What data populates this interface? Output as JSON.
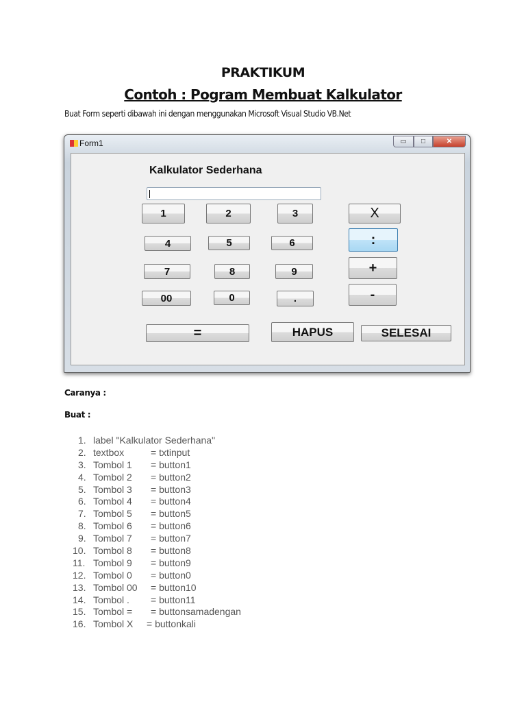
{
  "heading": "PRAKTIKUM",
  "title": "Contoh : Pogram Membuat Kalkulator",
  "subtitle": "Buat Form seperti dibawah ini dengan menggunakan Microsoft Visual Studio VB.Net",
  "window": {
    "title": "Form1",
    "minimize": "▭",
    "maximize": "□",
    "close": "✕",
    "label": "Kalkulator Sederhana",
    "textbox_value": "",
    "buttons": {
      "b1": "1",
      "b2": "2",
      "b3": "3",
      "kali": "X",
      "b4": "4",
      "b5": "5",
      "b6": "6",
      "bagi": ":",
      "b7": "7",
      "b8": "8",
      "b9": "9",
      "tambah": "+",
      "b00": "00",
      "b0": "0",
      "titik": ".",
      "kurang": "-",
      "sama": "=",
      "hapus": "HAPUS",
      "selesai": "SELESAI"
    }
  },
  "caranya": "Caranya :",
  "buat": "Buat :",
  "steps": [
    {
      "n": "1.",
      "a": "label \"Kalkulator Sederhana\"",
      "b": ""
    },
    {
      "n": "2.",
      "a": "textbox",
      "b": "= txtinput"
    },
    {
      "n": "3.",
      "a": "Tombol 1",
      "b": "= button1"
    },
    {
      "n": "4.",
      "a": "Tombol 2",
      "b": "= button2"
    },
    {
      "n": "5.",
      "a": "Tombol 3",
      "b": "= button3"
    },
    {
      "n": "6.",
      "a": "Tombol 4",
      "b": "= button4"
    },
    {
      "n": "7.",
      "a": "Tombol 5",
      "b": "= button5"
    },
    {
      "n": "8.",
      "a": "Tombol 6",
      "b": "= button6"
    },
    {
      "n": "9.",
      "a": "Tombol 7",
      "b": "= button7"
    },
    {
      "n": "10.",
      "a": "Tombol 8",
      "b": "= button8"
    },
    {
      "n": "11.",
      "a": "Tombol 9",
      "b": "= button9"
    },
    {
      "n": "12.",
      "a": "Tombol 0",
      "b": "= button0"
    },
    {
      "n": "13.",
      "a": "Tombol 00",
      "b": "= button10"
    },
    {
      "n": "14.",
      "a": "Tombol .",
      "b": "= button11"
    },
    {
      "n": "15.",
      "a": "Tombol =",
      "b": "= buttonsamadengan"
    },
    {
      "n": "16.",
      "a": "Tombol X",
      "b": "= buttonkali"
    }
  ]
}
